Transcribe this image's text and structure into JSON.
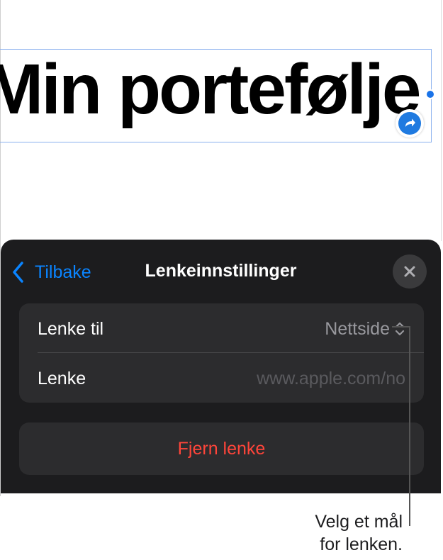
{
  "document": {
    "title": "Min portefølje"
  },
  "sheet": {
    "back_label": "Tilbake",
    "title": "Lenkeinnstillinger",
    "rows": [
      {
        "label": "Lenke til",
        "value": "Nettside"
      },
      {
        "label": "Lenke",
        "placeholder": "www.apple.com/no"
      }
    ],
    "remove_label": "Fjern lenke"
  },
  "callout": {
    "line1": "Velg et mål",
    "line2": "for lenken."
  },
  "colors": {
    "accent": "#0a84ff",
    "destructive": "#ff453a",
    "sheet_bg": "#1c1c1e",
    "group_bg": "#2c2c2e"
  },
  "icons": {
    "back": "chevron-left-icon",
    "close": "close-icon",
    "updown": "chevron-updown-icon",
    "link": "link-arrow-icon"
  }
}
